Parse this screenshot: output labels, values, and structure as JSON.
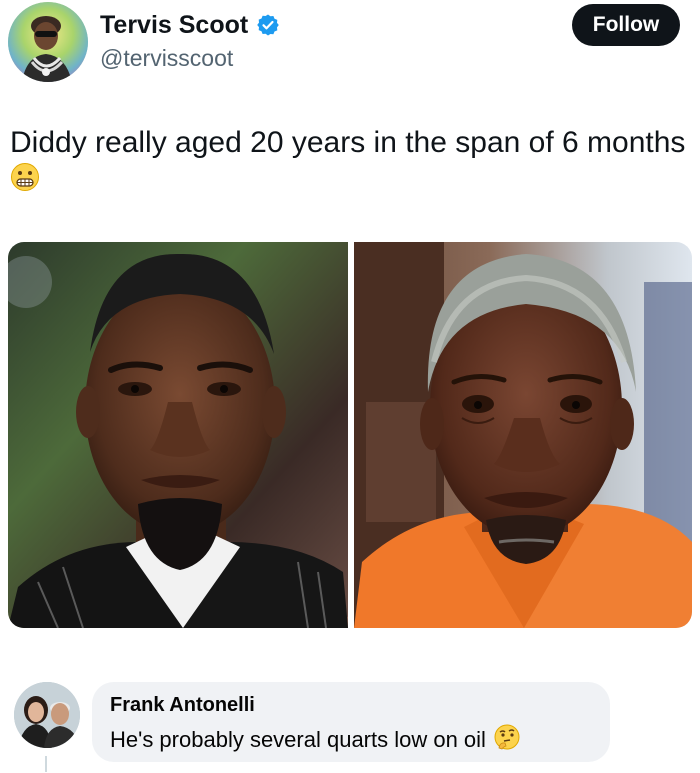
{
  "tweet": {
    "author_name": "Tervis Scoot",
    "handle": "@tervisscoot",
    "follow_label": "Follow",
    "text": "Diddy really aged 20 years in the span of 6 months",
    "text_emoji": "grimacing-face-emoji",
    "verified": true
  },
  "media": {
    "images": [
      {
        "name": "before-photo",
        "icon": "portrait-black-suit"
      },
      {
        "name": "after-photo",
        "icon": "portrait-orange-jumpsuit"
      }
    ]
  },
  "reply": {
    "author_name": "Frank Antonelli",
    "text": "He's probably several quarts low on oil",
    "text_emoji": "thinking-face-emoji"
  },
  "colors": {
    "follow_button_bg": "#0f1419",
    "verified_blue": "#1d9bf0",
    "handle_gray": "#536471",
    "reply_bubble_bg": "#f0f2f5",
    "jumpsuit_orange": "#f0782a"
  }
}
